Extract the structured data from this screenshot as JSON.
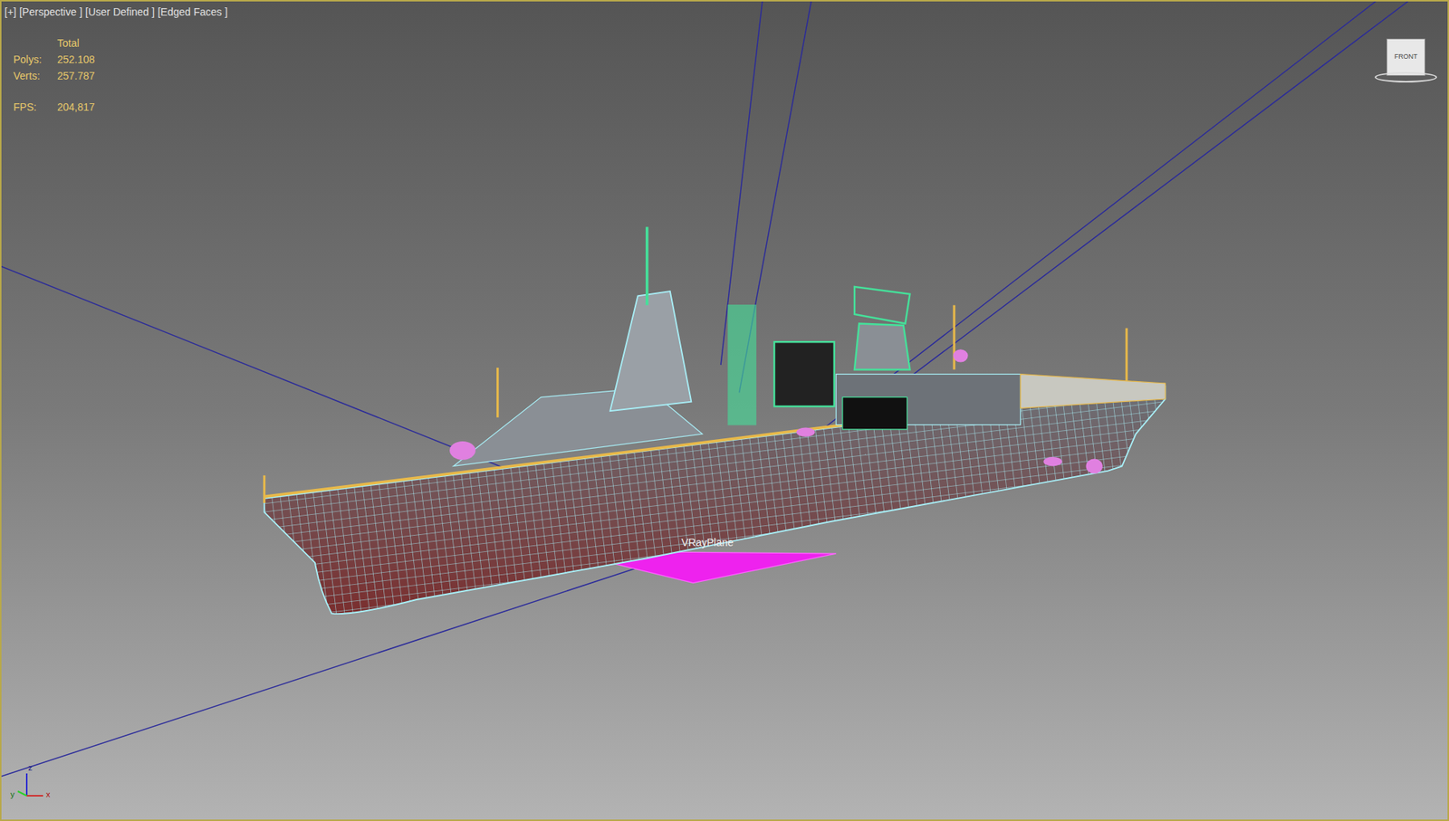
{
  "viewport": {
    "labels": [
      "[+]",
      "[Perspective ]",
      "[User Defined ]",
      "[Edged Faces ]"
    ]
  },
  "stats": {
    "header": "Total",
    "rows": [
      {
        "label": "Polys:",
        "value": "252.108"
      },
      {
        "label": "Verts:",
        "value": "257.787"
      }
    ],
    "fps": {
      "label": "FPS:",
      "value": "204,817"
    }
  },
  "helper": {
    "label": "VRayPlane"
  },
  "viewcube": {
    "face": "FRONT"
  },
  "axes": [
    "x",
    "y",
    "z"
  ]
}
